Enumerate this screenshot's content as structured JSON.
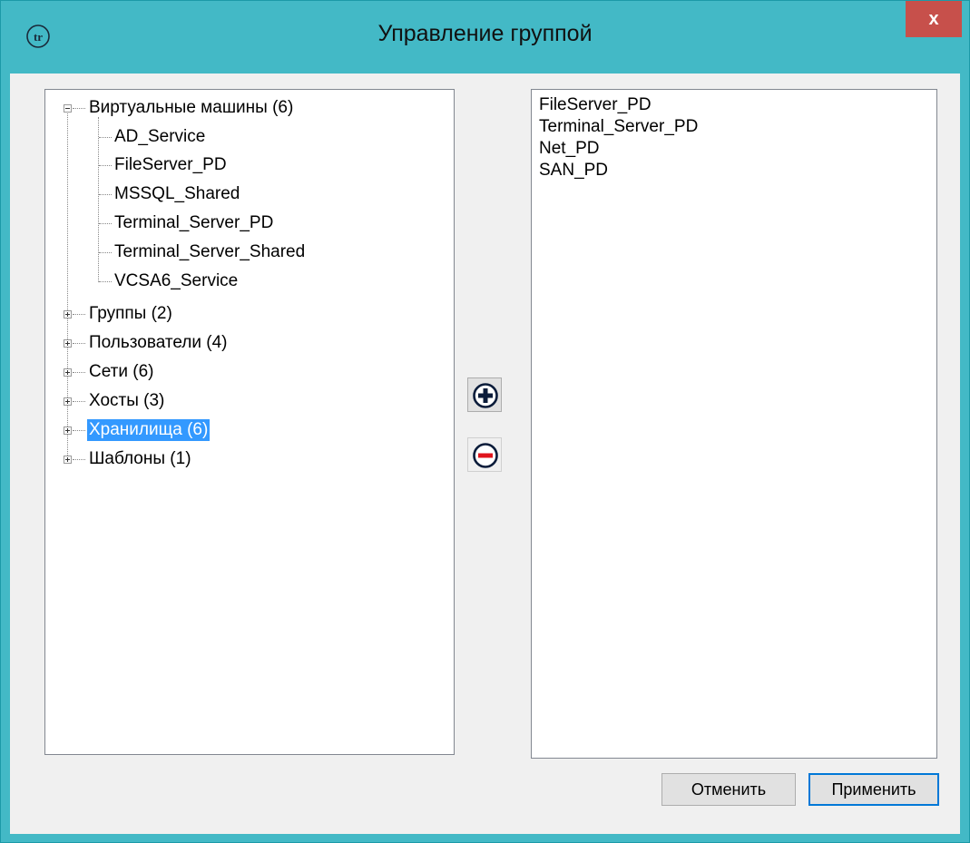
{
  "window": {
    "title": "Управление группой",
    "close_label": "x",
    "accent_color": "#43b9c6",
    "close_color": "#c7504b"
  },
  "tree": {
    "root": {
      "label": "Виртуальные машины (6)",
      "expanded": true,
      "children": [
        "AD_Service",
        "FileServer_PD",
        "MSSQL_Shared",
        "Terminal_Server_PD",
        "Terminal_Server_Shared",
        "VCSA6_Service"
      ]
    },
    "groups": [
      {
        "label": "Группы (2)"
      },
      {
        "label": "Пользователи (4)"
      },
      {
        "label": "Сети (6)"
      },
      {
        "label": "Хосты (3)"
      },
      {
        "label": "Хранилища (6)",
        "selected": true
      },
      {
        "label": "Шаблоны (1)"
      }
    ],
    "selection_color": "#3399ff"
  },
  "members": [
    "FileServer_PD",
    "Terminal_Server_PD",
    "Net_PD",
    "SAN_PD"
  ],
  "side_buttons": {
    "add_icon": "plus-circle-icon",
    "remove_icon": "minus-circle-icon"
  },
  "footer": {
    "cancel_label": "Отменить",
    "apply_label": "Применить"
  }
}
